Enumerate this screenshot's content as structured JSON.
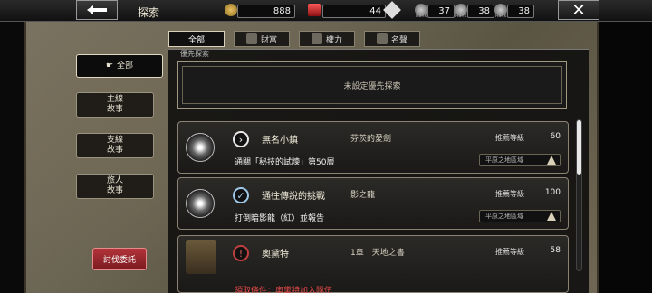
{
  "header": {
    "title": "探索",
    "resources": [
      {
        "icon": "gold-coin-icon",
        "value": "888"
      },
      {
        "icon": "red-gem-icon",
        "value": "44"
      },
      {
        "icon": "rank-crest-1-icon",
        "value": "37",
        "label": "Rank"
      },
      {
        "icon": "rank-crest-2-icon",
        "value": "38",
        "label": "Rank"
      },
      {
        "icon": "rank-crest-3-icon",
        "value": "38",
        "label": "Rank"
      }
    ]
  },
  "tabs": [
    {
      "label": "全部",
      "icon": "",
      "active": true
    },
    {
      "label": "財富",
      "icon": "wealth-icon",
      "active": false
    },
    {
      "label": "權力",
      "icon": "power-icon",
      "active": false
    },
    {
      "label": "名聲",
      "icon": "fame-icon",
      "active": false
    }
  ],
  "nav": [
    {
      "label": "全部",
      "icon": "hand-pointer-icon",
      "active": true
    },
    {
      "label": "主線\n故事",
      "active": false
    },
    {
      "label": "支線\n故事",
      "active": false
    },
    {
      "label": "旅人\n故事",
      "active": false
    }
  ],
  "subjugate_button": "討伐委託",
  "priority": {
    "label": "優先探索",
    "empty_text": "未設定優先探索"
  },
  "quests": [
    {
      "state_icon": "arrow-right-icon",
      "title": "無名小鎮",
      "subtitle": "芬茨的愛劍",
      "objective": "通關「秘技的試煉」第50層",
      "level_label": "推薦等級",
      "level": "60",
      "region": "平原之地區域"
    },
    {
      "state_icon": "check-icon",
      "title": "通往傳說的挑戰",
      "subtitle": "影之龍",
      "objective": "打倒暗影龍（紅）並報告",
      "level_label": "推薦等級",
      "level": "100",
      "region": "平原之地區域"
    },
    {
      "state_icon": "new-quest-icon",
      "title": "奧黛特",
      "subtitle": "1章　天地之書",
      "objective": "領取條件：奧黛特加入隊伍",
      "level_label": "推薦等級",
      "level": "58",
      "region": ""
    }
  ]
}
